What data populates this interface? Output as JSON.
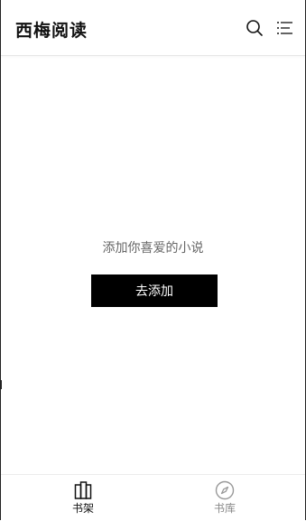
{
  "header": {
    "title": "西梅阅读",
    "search_icon": "search-icon",
    "menu_icon": "list-menu-icon"
  },
  "empty_state": {
    "message": "添加你喜爱的小说",
    "button_label": "去添加"
  },
  "tabbar": {
    "tabs": [
      {
        "label": "书架",
        "icon": "bookshelf-icon",
        "active": true
      },
      {
        "label": "书库",
        "icon": "compass-icon",
        "active": false
      }
    ]
  },
  "colors": {
    "button_bg": "#000000",
    "active_tab": "#111111",
    "inactive_tab": "#888888",
    "secondary_text": "#666666"
  }
}
